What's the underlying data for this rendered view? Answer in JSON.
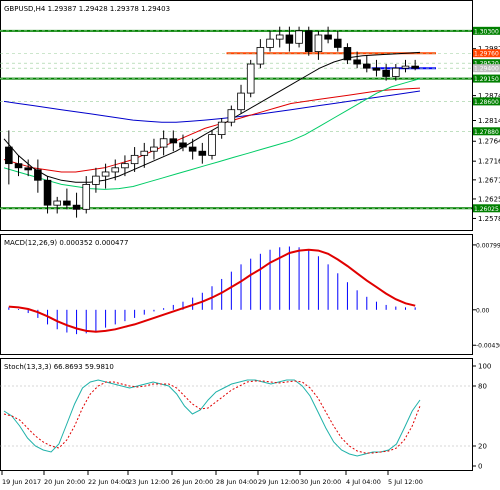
{
  "colors": {
    "up_candle": "#ffffff",
    "down_candle": "#000000",
    "ma_fast": "#00cc66",
    "ma_mid": "#e00000",
    "ma_slow": "#0000cc",
    "ma_black": "#000000",
    "level_line": "#008000",
    "resistance": "#ff4500",
    "support": "#0000ff",
    "macd_hist": "#0000ff",
    "macd_signal": "#e00000",
    "stoch_main": "#20b2aa",
    "stoch_signal": "#e00000"
  },
  "chart_data": [
    {
      "type": "candlestick",
      "title": "GBPUSD,H4  1.29387 1.29428 1.29378 1.29403",
      "ylim": [
        1.2555,
        1.3085
      ],
      "y_ticks": [
        "1.29870",
        "1.29400",
        "1.28740",
        "1.28140",
        "1.27640",
        "1.27160",
        "1.26710",
        "1.26250",
        "1.25780"
      ],
      "price_tags": [
        "1.30300",
        "1.29760",
        "1.29520",
        "1.29400",
        "1.29150",
        "1.28600",
        "1.27880",
        "1.26025"
      ],
      "horizontal_levels": [
        {
          "value": 1.303,
          "kind": "level"
        },
        {
          "value": 1.2915,
          "kind": "level"
        },
        {
          "value": 1.26025,
          "kind": "level"
        },
        {
          "value": 1.2976,
          "kind": "resistance"
        },
        {
          "value": 1.294,
          "kind": "support"
        }
      ],
      "candles": [
        [
          1.275,
          1.279,
          1.266,
          1.271
        ],
        [
          1.271,
          1.273,
          1.268,
          1.27
        ],
        [
          1.27,
          1.272,
          1.268,
          1.2695
        ],
        [
          1.2695,
          1.272,
          1.264,
          1.267
        ],
        [
          1.267,
          1.268,
          1.259,
          1.261
        ],
        [
          1.261,
          1.263,
          1.259,
          1.262
        ],
        [
          1.262,
          1.265,
          1.26,
          1.261
        ],
        [
          1.261,
          1.264,
          1.258,
          1.26
        ],
        [
          1.26,
          1.268,
          1.259,
          1.266
        ],
        [
          1.266,
          1.27,
          1.264,
          1.268
        ],
        [
          1.268,
          1.271,
          1.265,
          1.269
        ],
        [
          1.269,
          1.272,
          1.267,
          1.27
        ],
        [
          1.27,
          1.273,
          1.268,
          1.271
        ],
        [
          1.271,
          1.275,
          1.269,
          1.273
        ],
        [
          1.273,
          1.276,
          1.27,
          1.274
        ],
        [
          1.274,
          1.277,
          1.272,
          1.275
        ],
        [
          1.275,
          1.279,
          1.273,
          1.277
        ],
        [
          1.277,
          1.279,
          1.274,
          1.276
        ],
        [
          1.276,
          1.278,
          1.274,
          1.275
        ],
        [
          1.275,
          1.277,
          1.272,
          1.274
        ],
        [
          1.274,
          1.276,
          1.271,
          1.273
        ],
        [
          1.273,
          1.279,
          1.272,
          1.278
        ],
        [
          1.278,
          1.282,
          1.277,
          1.281
        ],
        [
          1.281,
          1.285,
          1.28,
          1.284
        ],
        [
          1.284,
          1.29,
          1.283,
          1.288
        ],
        [
          1.288,
          1.296,
          1.287,
          1.295
        ],
        [
          1.295,
          1.301,
          1.294,
          1.299
        ],
        [
          1.299,
          1.303,
          1.298,
          1.301
        ],
        [
          1.301,
          1.304,
          1.299,
          1.302
        ],
        [
          1.302,
          1.304,
          1.298,
          1.3
        ],
        [
          1.3,
          1.304,
          1.299,
          1.303
        ],
        [
          1.303,
          1.304,
          1.297,
          1.298
        ],
        [
          1.298,
          1.303,
          1.296,
          1.302
        ],
        [
          1.302,
          1.304,
          1.3,
          1.301
        ],
        [
          1.301,
          1.303,
          1.298,
          1.299
        ],
        [
          1.299,
          1.3,
          1.295,
          1.296
        ],
        [
          1.296,
          1.298,
          1.294,
          1.295
        ],
        [
          1.295,
          1.297,
          1.293,
          1.294
        ],
        [
          1.294,
          1.296,
          1.292,
          1.2935
        ],
        [
          1.2935,
          1.295,
          1.291,
          1.292
        ],
        [
          1.292,
          1.295,
          1.291,
          1.294
        ],
        [
          1.294,
          1.296,
          1.293,
          1.2945
        ],
        [
          1.2945,
          1.296,
          1.2935,
          1.294
        ]
      ],
      "ma_fast": [
        1.27,
        1.269,
        1.268,
        1.267,
        1.266,
        1.2655,
        1.265,
        1.2648,
        1.265,
        1.2655,
        1.2665,
        1.2675,
        1.2685,
        1.2695,
        1.2705,
        1.2715,
        1.2725,
        1.2735,
        1.2745,
        1.2755,
        1.2765,
        1.278,
        1.28,
        1.282,
        1.284,
        1.286,
        1.288,
        1.2895,
        1.2905,
        1.2915
      ],
      "ma_mid": [
        1.272,
        1.271,
        1.27,
        1.2695,
        1.269,
        1.269,
        1.2695,
        1.27,
        1.271,
        1.272,
        1.2735,
        1.275,
        1.2765,
        1.278,
        1.2795,
        1.2805,
        1.2815,
        1.2825,
        1.2835,
        1.2845,
        1.2855,
        1.286,
        1.2865,
        1.287,
        1.2875,
        1.288,
        1.2885,
        1.2888,
        1.289,
        1.2892
      ],
      "ma_slow": [
        1.286,
        1.2855,
        1.285,
        1.2845,
        1.284,
        1.2835,
        1.283,
        1.2825,
        1.282,
        1.2815,
        1.2812,
        1.281,
        1.281,
        1.2812,
        1.2815,
        1.2818,
        1.2822,
        1.2826,
        1.283,
        1.2835,
        1.284,
        1.2845,
        1.285,
        1.2855,
        1.286,
        1.2865,
        1.287,
        1.2875,
        1.288,
        1.2885
      ],
      "ma_black": [
        1.277,
        1.273,
        1.27,
        1.268,
        1.267,
        1.2665,
        1.2665,
        1.267,
        1.268,
        1.2695,
        1.271,
        1.2725,
        1.274,
        1.276,
        1.278,
        1.28,
        1.282,
        1.284,
        1.286,
        1.288,
        1.29,
        1.292,
        1.294,
        1.2955,
        1.2965,
        1.297,
        1.2972,
        1.2974,
        1.2976,
        1.2978
      ]
    },
    {
      "type": "bar+line",
      "title": "MACD(12,26,9) 0.000352 0.000477",
      "y_ticks": [
        "0.007996",
        "0.00",
        "-0.004366"
      ],
      "ylim": [
        -0.0052,
        0.0086
      ],
      "histogram": [
        0.0003,
        0.0001,
        -0.0004,
        -0.001,
        -0.0018,
        -0.0024,
        -0.0028,
        -0.003,
        -0.0029,
        -0.0026,
        -0.0022,
        -0.0018,
        -0.0014,
        -0.001,
        -0.0006,
        -0.0002,
        0.0002,
        0.0006,
        0.001,
        0.0015,
        0.0021,
        0.0029,
        0.0038,
        0.0047,
        0.0056,
        0.0063,
        0.0069,
        0.0074,
        0.0077,
        0.0078,
        0.0077,
        0.0073,
        0.0066,
        0.0056,
        0.0045,
        0.0034,
        0.0024,
        0.0016,
        0.001,
        0.0006,
        0.0004,
        0.0003,
        0.0003
      ],
      "signal": [
        0.0004,
        0.0003,
        0.0001,
        -0.0003,
        -0.0008,
        -0.0014,
        -0.0019,
        -0.0023,
        -0.0026,
        -0.0027,
        -0.0026,
        -0.0024,
        -0.0021,
        -0.0018,
        -0.0014,
        -0.001,
        -0.0006,
        -0.0002,
        0.0002,
        0.0006,
        0.001,
        0.0015,
        0.0021,
        0.0028,
        0.0035,
        0.0043,
        0.005,
        0.0058,
        0.0064,
        0.007,
        0.0073,
        0.0074,
        0.0073,
        0.0069,
        0.0062,
        0.0054,
        0.0045,
        0.0036,
        0.0028,
        0.002,
        0.0013,
        0.0008,
        0.0005
      ]
    },
    {
      "type": "line",
      "title": "Stoch(13,3,3) 66.8693 59.9810",
      "y_ticks": [
        "100",
        "80",
        "20",
        "0"
      ],
      "ylim": [
        0,
        100
      ],
      "main": [
        55,
        50,
        40,
        28,
        20,
        16,
        14,
        22,
        42,
        62,
        78,
        84,
        86,
        84,
        82,
        80,
        78,
        80,
        82,
        84,
        82,
        80,
        72,
        60,
        52,
        56,
        66,
        74,
        78,
        82,
        84,
        86,
        86,
        84,
        82,
        84,
        86,
        86,
        80,
        70,
        54,
        38,
        24,
        16,
        12,
        10,
        12,
        14,
        14,
        16,
        22,
        38,
        55,
        66
      ],
      "signal": [
        52,
        50,
        46,
        38,
        30,
        24,
        20,
        18,
        26,
        40,
        58,
        72,
        80,
        84,
        84,
        82,
        80,
        79,
        80,
        82,
        82,
        82,
        78,
        70,
        62,
        57,
        58,
        64,
        70,
        76,
        80,
        84,
        85,
        85,
        84,
        83,
        84,
        85,
        84,
        78,
        68,
        54,
        40,
        28,
        20,
        15,
        13,
        13,
        14,
        15,
        18,
        26,
        40,
        60
      ]
    }
  ],
  "x_axis_labels": [
    "19 Jun 2017",
    "20 Jun 20:00",
    "22 Jun 04:00",
    "23 Jun 12:00",
    "26 Jun 20:00",
    "28 Jun 04:00",
    "29 Jun 12:00",
    "30 Jun 20:00",
    "4 Jul 04:00",
    "5 Jul 12:00"
  ]
}
